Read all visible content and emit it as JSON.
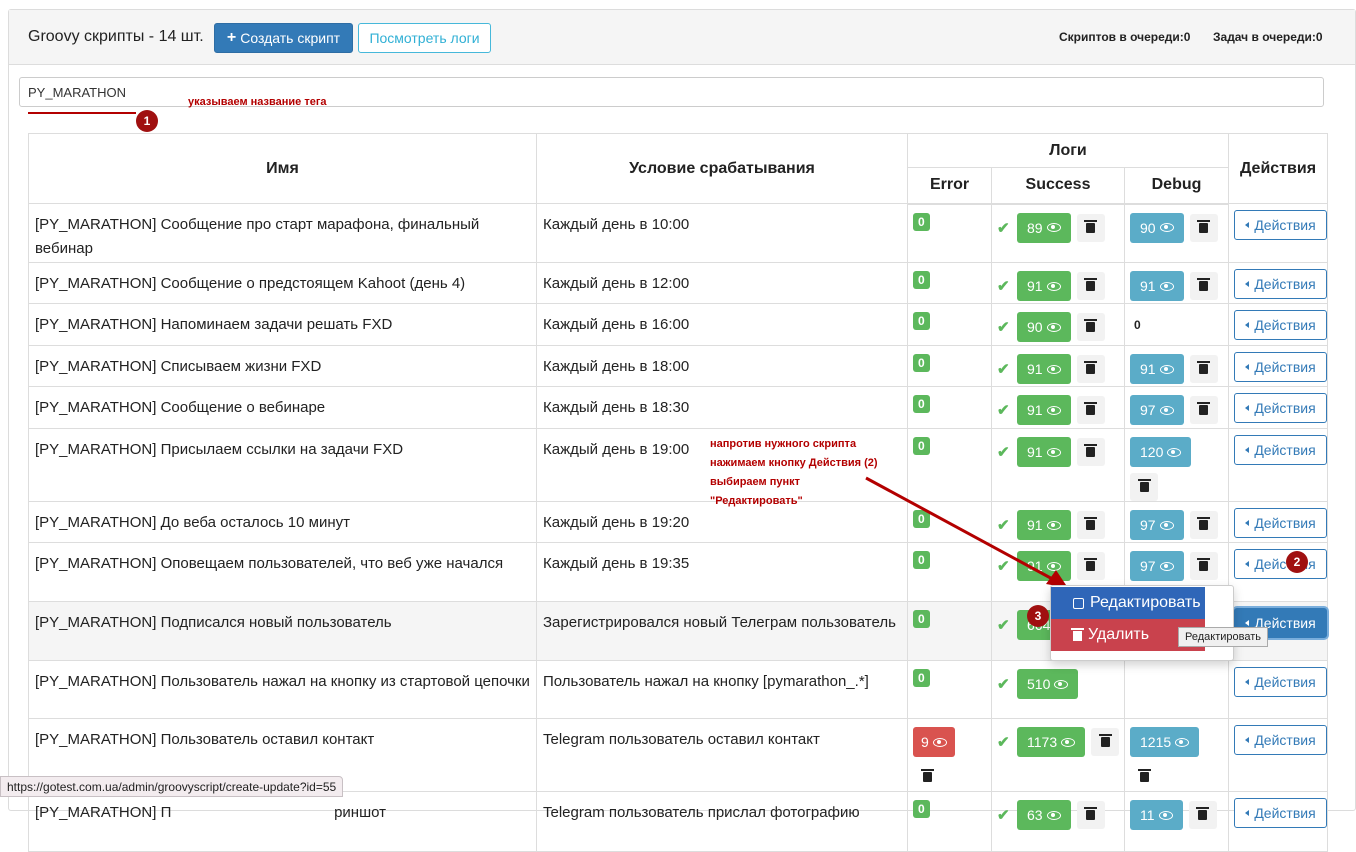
{
  "header": {
    "title": "Groovy скрипты - 14 шт.",
    "create_button": "Создать скрипт",
    "logs_button": "Посмотреть логи",
    "scripts_queue": "Скриптов в очереди:0",
    "tasks_queue": "Задач в очереди:0"
  },
  "search": {
    "value": "PY_MARATHON"
  },
  "annotations": {
    "tag_hint": "указываем название тега",
    "step1": "1",
    "step2": "2",
    "step3": "3",
    "instruction_line1": "напротив нужного скрипта",
    "instruction_line2": "нажимаем кнопку Действия (2)",
    "instruction_line3": "выбираем пункт",
    "instruction_line4": "\"Редактировать\"",
    "arrow_color": "#b30000"
  },
  "table": {
    "headers": {
      "name": "Имя",
      "condition": "Условие срабатывания",
      "logs": "Логи",
      "error": "Error",
      "success": "Success",
      "debug": "Debug",
      "actions": "Действия"
    },
    "action_label": "Действия",
    "rows": [
      {
        "name": "[PY_MARATHON] Сообщение про старт марафона, финальный вебинар",
        "condition": "Каждый день в 10:00",
        "error": "0",
        "success": "89",
        "debug": "90"
      },
      {
        "name": "[PY_MARATHON] Сообщение о предстоящем Kahoot (день 4)",
        "condition": "Каждый день в 12:00",
        "error": "0",
        "success": "91",
        "debug": "91"
      },
      {
        "name": "[PY_MARATHON] Напоминаем задачи решать FXD",
        "condition": "Каждый день в 16:00",
        "error": "0",
        "success": "90",
        "debug": "0"
      },
      {
        "name": "[PY_MARATHON] Списываем жизни FXD",
        "condition": "Каждый день в 18:00",
        "error": "0",
        "success": "91",
        "debug": "91"
      },
      {
        "name": "[PY_MARATHON] Сообщение о вебинаре",
        "condition": "Каждый день в 18:30",
        "error": "0",
        "success": "91",
        "debug": "97"
      },
      {
        "name": "[PY_MARATHON] Присылаем ссылки на задачи FXD",
        "condition": "Каждый день в 19:00",
        "error": "0",
        "success": "91",
        "debug": "120"
      },
      {
        "name": "[PY_MARATHON] До веба осталось 10 минут",
        "condition": "Каждый день в 19:20",
        "error": "0",
        "success": "91",
        "debug": "97"
      },
      {
        "name": "[PY_MARATHON] Оповещаем пользователей, что веб уже начался",
        "condition": "Каждый день в 19:35",
        "error": "0",
        "success": "91",
        "debug": "97"
      },
      {
        "name": "[PY_MARATHON] Подписался новый пользователь",
        "condition": "Зарегистрировался новый Телеграм пользователь",
        "error": "0",
        "success": "664",
        "debug": ""
      },
      {
        "name": "[PY_MARATHON] Пользователь нажал на кнопку из стартовой цепочки",
        "condition": "Пользователь нажал на кнопку [pymarathon_.*]",
        "error": "0",
        "success": "510",
        "debug": ""
      },
      {
        "name": "[PY_MARATHON] Пользователь оставил контакт",
        "condition": "Telegram пользователь оставил контакт",
        "error": "9",
        "success": "1173",
        "debug": "1215"
      },
      {
        "name": "[PY_MARATHON] П",
        "name_tail": "риншот",
        "condition": "Telegram пользователь прислал фотографию",
        "error": "0",
        "success": "63",
        "debug": "11"
      }
    ]
  },
  "dropdown": {
    "edit": "Редактировать",
    "delete": "Удалить"
  },
  "tooltip": "Редактировать",
  "status_url": "https://gotest.com.ua/admin/groovyscript/create-update?id=55"
}
